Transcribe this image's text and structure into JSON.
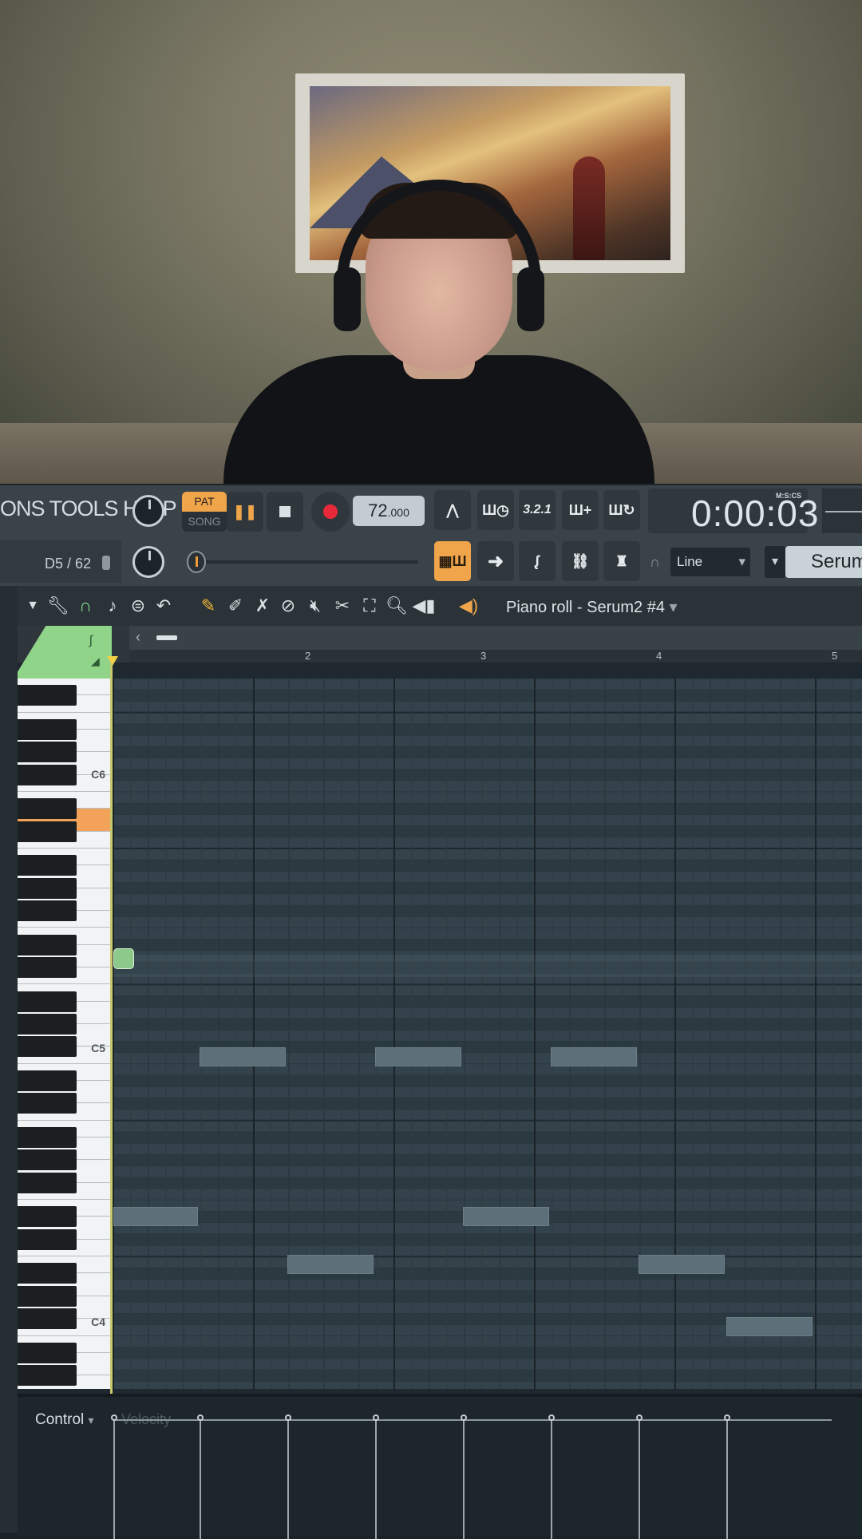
{
  "toolbar": {
    "menu_text": "ONS TOOLS HELP",
    "pat_label": "PAT",
    "song_label": "SONG",
    "tempo_main": "72",
    "tempo_decimal": ".000",
    "snap_hint": "D5 / 62",
    "clock_time": "0:00:03",
    "clock_unit": "M:S:CS",
    "btn_countdown": "3.2.1",
    "tool_mode_select": "Line",
    "channel_name": "Serum"
  },
  "piano_roll": {
    "title": "Piano roll - Serum2 #4",
    "bar_numbers": [
      "2",
      "3",
      "4",
      "5"
    ],
    "octave_labels": [
      "C6",
      "C5",
      "C4"
    ],
    "control_label": "Control",
    "control_sub": "Velocity"
  },
  "colors": {
    "accent_orange": "#f0a54a",
    "pat_active": "#f0a54a",
    "record_red": "#e8293a",
    "piano_tab_green": "#8fd489",
    "highlighted_key": "#f3a25a",
    "note_fill": "#5d6f78"
  },
  "icons": {
    "piano_roll_tools": [
      "dropdown-arrow-icon",
      "wrench-icon",
      "magnet-icon",
      "note-icon",
      "menu-icon",
      "undo-icon",
      "pencil-icon",
      "brush-icon",
      "delete-brush-icon",
      "mute-icon",
      "speaker-mute-icon",
      "slice-icon",
      "select-icon",
      "zoom-icon",
      "playback-icon",
      "speaker-icon"
    ]
  }
}
